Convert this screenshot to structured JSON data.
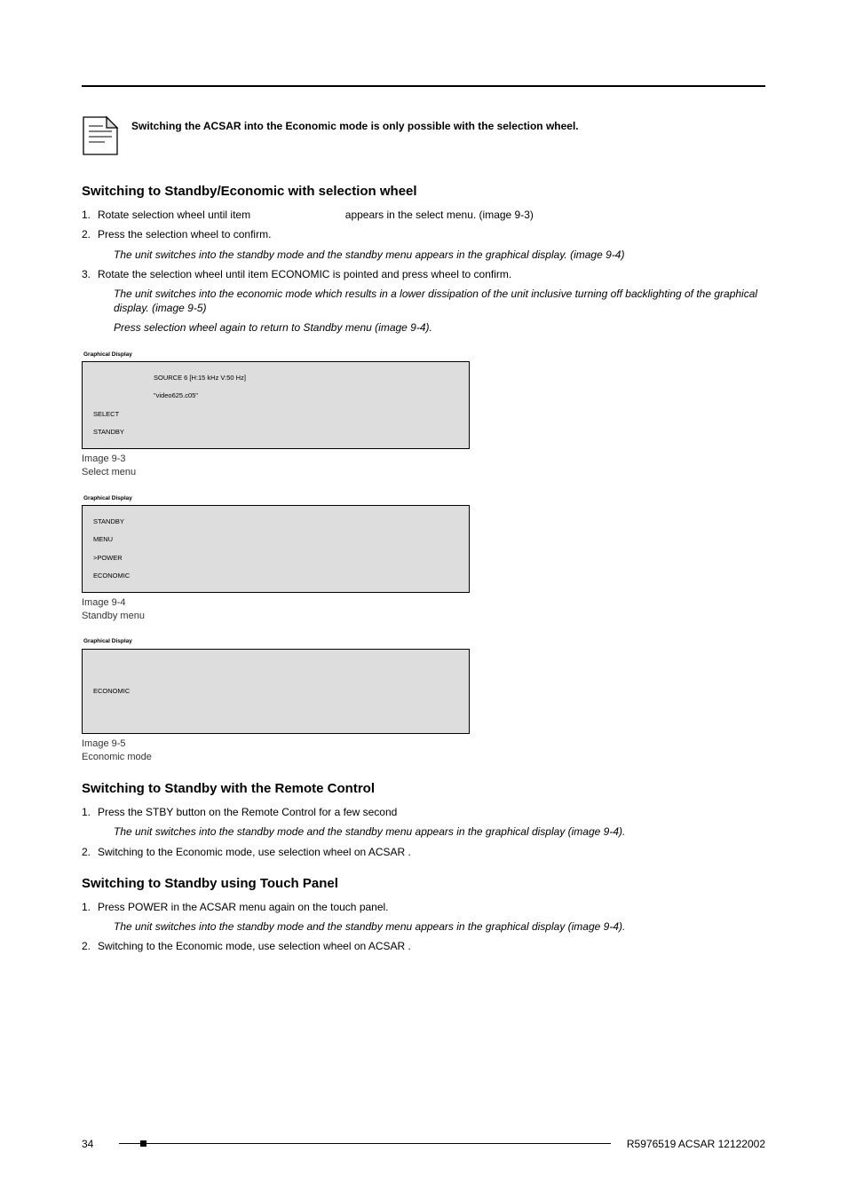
{
  "noteText": "Switching the ACSAR into the Economic mode is only possible with the selection wheel.",
  "section1": {
    "heading": "Switching to Standby/Economic with selection wheel",
    "step1_a": "Rotate selection wheel until item",
    "step1_b": "appears in the select menu. (image 9-3)",
    "step2": "Press the selection wheel to confirm.",
    "step2_sub": "The unit switches into the standby mode and the standby menu appears in the graphical display. (image 9-4)",
    "step3": "Rotate the selection wheel until item ECONOMIC is pointed and press wheel to confirm.",
    "step3_sub1": "The unit switches into the economic mode which results in a lower dissipation of the unit inclusive turning off backlighting of the graphical display. (image 9-5)",
    "step3_sub2": "Press selection wheel again to return to Standby menu (image 9-4)."
  },
  "gd1": {
    "label": "Graphical Display",
    "line1": "SOURCE 6 [H:15 kHz       V:50 Hz]",
    "line2": "\"video625.c05\"",
    "line3": "SELECT",
    "line4": "STANDBY",
    "cap_a": "Image 9-3",
    "cap_b": "Select menu"
  },
  "gd2": {
    "label": "Graphical Display",
    "line1": "STANDBY",
    "line2": "MENU",
    "line3": ">POWER",
    "line4": "ECONOMIC",
    "cap_a": "Image 9-4",
    "cap_b": "Standby menu"
  },
  "gd3": {
    "label": "Graphical Display",
    "line1": "ECONOMIC",
    "cap_a": "Image 9-5",
    "cap_b": "Economic mode"
  },
  "section2": {
    "heading": "Switching to Standby with the Remote Control",
    "step1": "Press the STBY button on the Remote Control for a few second",
    "step1_sub": "The unit switches into the standby mode and the standby menu appears in the graphical display (image 9-4).",
    "step2": "Switching to the Economic mode, use selection wheel on ACSAR ."
  },
  "section3": {
    "heading": "Switching to Standby using Touch Panel",
    "step1": "Press POWER in the ACSAR menu again on the touch panel.",
    "step1_sub": "The unit switches into the standby mode and the standby menu appears in the graphical display (image 9-4).",
    "step2": "Switching to the Economic mode, use selection wheel on ACSAR ."
  },
  "footer": {
    "page": "34",
    "doc": "R5976519  ACSAR  12122002"
  }
}
